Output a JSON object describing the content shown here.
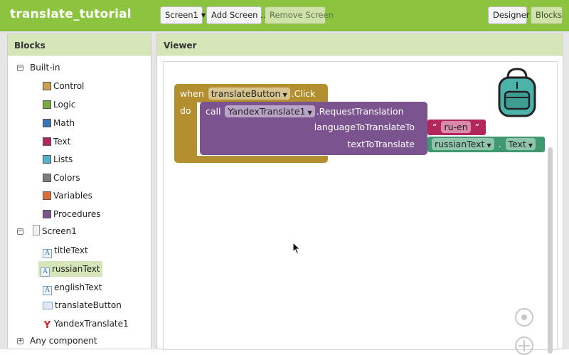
{
  "app": {
    "project_title": "translate_tutorial"
  },
  "toolbar": {
    "screen_select": "Screen1",
    "add_screen": "Add Screen ...",
    "remove_screen": "Remove Screen",
    "designer": "Designer",
    "blocks": "Blocks"
  },
  "blocks_panel": {
    "header": "Blocks",
    "builtin_label": "Built-in",
    "builtin": [
      {
        "label": "Control",
        "color": "#c8a24a"
      },
      {
        "label": "Logic",
        "color": "#7cab3e"
      },
      {
        "label": "Math",
        "color": "#3b73b9"
      },
      {
        "label": "Text",
        "color": "#b3265b"
      },
      {
        "label": "Lists",
        "color": "#53b3cf"
      },
      {
        "label": "Colors",
        "color": "#7d7d7d"
      },
      {
        "label": "Variables",
        "color": "#e06d35"
      },
      {
        "label": "Procedures",
        "color": "#7b548f"
      }
    ],
    "screen_label": "Screen1",
    "components": [
      {
        "label": "titleText",
        "icon": "text-label-icon"
      },
      {
        "label": "russianText",
        "icon": "text-label-icon"
      },
      {
        "label": "englishText",
        "icon": "text-label-icon"
      },
      {
        "label": "translateButton",
        "icon": "button-icon"
      },
      {
        "label": "YandexTranslate1",
        "icon": "yandex-icon"
      }
    ],
    "any_component_label": "Any component"
  },
  "viewer": {
    "header": "Viewer",
    "event_block": {
      "when": "when",
      "component": "translateButton",
      "event": ".Click",
      "do": "do"
    },
    "call_block": {
      "call": "call",
      "component": "YandexTranslate1",
      "method": ".RequestTranslation",
      "param1": "languageToTranslateTo",
      "param2": "textToTranslate"
    },
    "text_block": {
      "open_quote": "“",
      "value": "ru-en",
      "close_quote": "”"
    },
    "getter_block": {
      "component": "russianText",
      "dot": ".",
      "property": "Text"
    },
    "colors": {
      "event": "#b38f2f",
      "call": "#7b548f",
      "text": "#b3265b",
      "getter": "#3f9870"
    }
  }
}
